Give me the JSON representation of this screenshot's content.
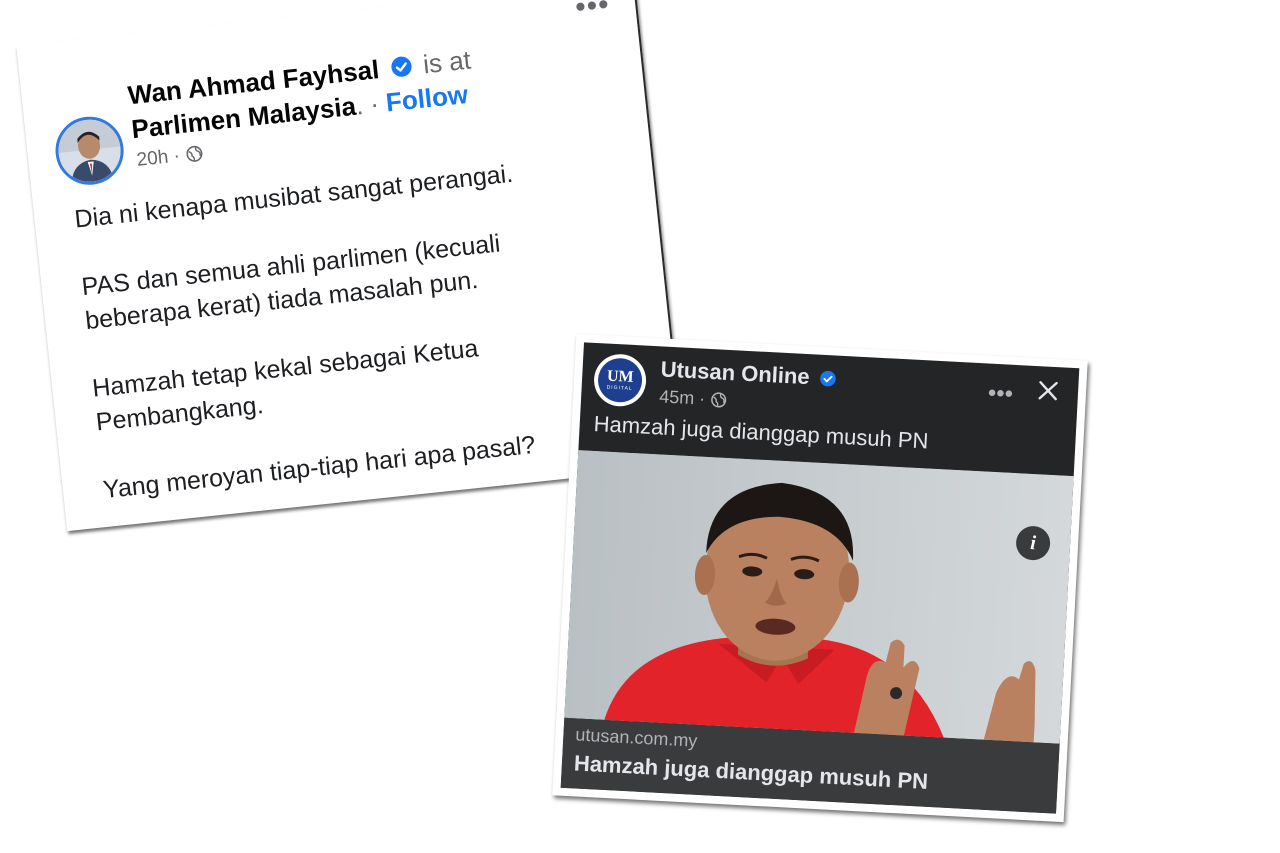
{
  "post": {
    "author_name": "Wan Ahmad Fayhsal",
    "is_at": "is at",
    "place": "Parlimen Malaysia",
    "separator": ". ·",
    "follow_label": "Follow",
    "time": "20h ·",
    "menu": "•••",
    "paragraphs": [
      "Dia ni kenapa musibat sangat perangai.",
      "PAS dan semua ahli parlimen (kecuali beberapa kerat) tiada masalah pun.",
      "Hamzah tetap kekal sebagai Ketua Pembangkang.",
      "Yang meroyan tiap-tiap hari apa pasal?"
    ],
    "avatar_icon": "profile-photo",
    "privacy_icon": "globe-icon"
  },
  "shared": {
    "page_name": "Utusan Online",
    "logo_text": "UM",
    "logo_subtext": "DIGITAL",
    "time": "45m ·",
    "menu": "•••",
    "caption": "Hamzah juga dianggap musuh PN",
    "info_icon": "i",
    "domain": "utusan.com.my",
    "headline": "Hamzah juga dianggap musuh PN"
  },
  "colors": {
    "facebook_blue": "#1877f2",
    "dark_surface": "#242526",
    "dark_footer": "#3a3b3c",
    "shirt_red": "#e3232a"
  }
}
